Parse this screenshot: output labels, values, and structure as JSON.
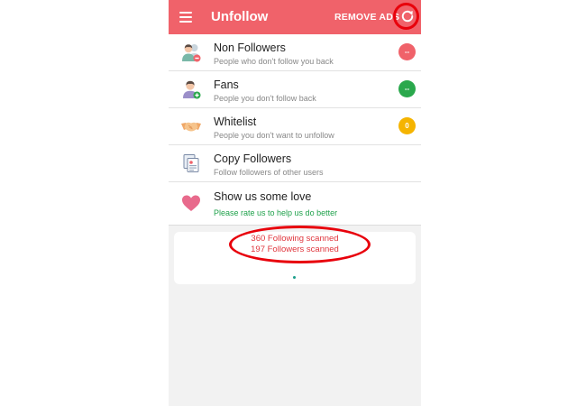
{
  "colors": {
    "primary": "#f0626a",
    "annotation": "#e8000b"
  },
  "appbar": {
    "title": "Unfollow",
    "remove_ads": "REMOVE ADS",
    "menu_icon": "menu-icon",
    "refresh_icon": "refresh-icon"
  },
  "menu": {
    "items": [
      {
        "title": "Non Followers",
        "subtitle": "People who don't follow you back",
        "badge": "--",
        "badge_color": "#f0626a",
        "icon": "non-followers-icon"
      },
      {
        "title": "Fans",
        "subtitle": "People you don't follow back",
        "badge": "--",
        "badge_color": "#2aa84c",
        "icon": "fans-icon"
      },
      {
        "title": "Whitelist",
        "subtitle": "People you don't want to unfollow",
        "badge": "0",
        "badge_color": "#f5b400",
        "icon": "handshake-icon"
      },
      {
        "title": "Copy Followers",
        "subtitle": "Follow followers of other users",
        "icon": "copy-followers-icon"
      },
      {
        "title": "Show us some love",
        "subtitle": "Please rate us to help us do better",
        "icon": "heart-icon"
      }
    ]
  },
  "scan": {
    "following": "360 Following scanned",
    "followers": "197 Followers scanned"
  }
}
